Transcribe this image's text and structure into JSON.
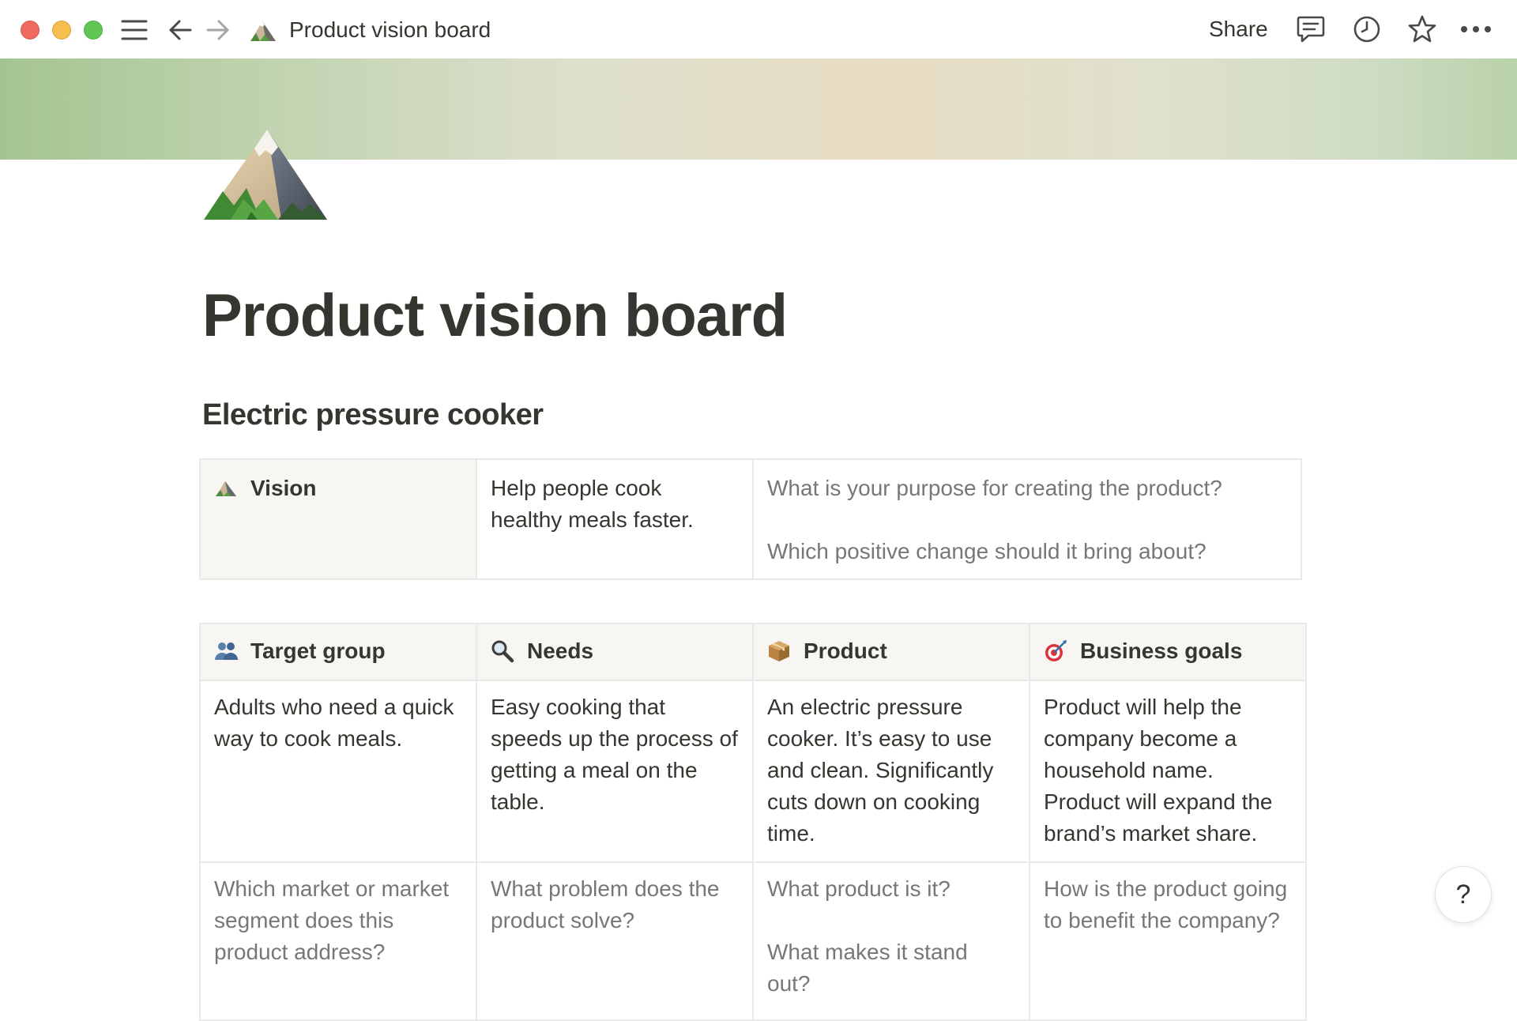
{
  "window": {
    "breadcrumb_title": "Product vision board",
    "share_label": "Share"
  },
  "page": {
    "title": "Product vision board",
    "section_heading": "Electric pressure cooker"
  },
  "vision": {
    "label": "Vision",
    "statement": "Help people cook healthy meals faster.",
    "hint_1": "What is your purpose for creating the product?",
    "hint_2": "Which positive change should it bring about?"
  },
  "board": {
    "columns": [
      {
        "label": "Target group",
        "icon": "people-icon"
      },
      {
        "label": "Needs",
        "icon": "magnifier-icon"
      },
      {
        "label": "Product",
        "icon": "package-icon"
      },
      {
        "label": "Business goals",
        "icon": "target-icon"
      }
    ],
    "answers": [
      "Adults who need a quick way to cook meals.",
      "Easy cooking that speeds up the process of getting a meal on the table.",
      "An electric pressure cooker. It’s easy to use and clean. Significantly cuts down on cooking time.",
      "Product will help the company become a household name. Product will expand the brand’s market share."
    ],
    "hints": [
      "Which market or market segment does this product address?",
      "What problem does the product solve?",
      "What product is it?",
      "How is the product going to benefit the company?"
    ],
    "hints_second": [
      "",
      "",
      "What makes it stand out?",
      ""
    ]
  },
  "help": {
    "label": "?"
  },
  "colors": {
    "text": "#37352f",
    "muted_text": "#787774",
    "header_bg": "#f7f6f3",
    "border": "#e9e9e7"
  }
}
